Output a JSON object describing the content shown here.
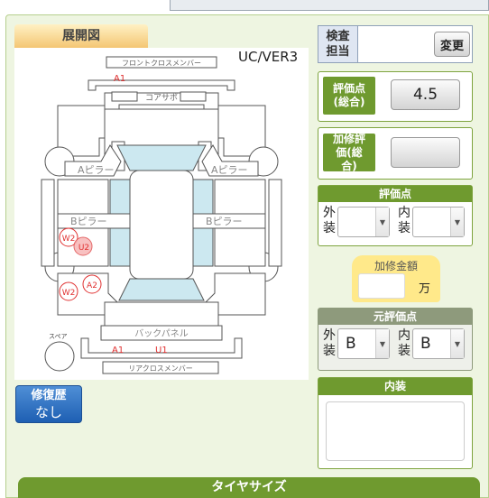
{
  "diagram": {
    "tab_label": "展開図",
    "version": "UC/VER3",
    "parts": {
      "front_cross": "フロントクロスメンバー",
      "core_support": "コアサポ",
      "a_pillar_left": "Aピラー",
      "a_pillar_right": "Aピラー",
      "b_pillar_left": "Bピラー",
      "b_pillar_right": "Bピラー",
      "back_panel": "バックパネル",
      "rear_cross": "リアクロスメンバー",
      "spare": "スペア"
    },
    "marks": {
      "a1_front": "A1",
      "w2_upper": "W2",
      "u2": "U2",
      "w2_lower": "W2",
      "a2": "A2",
      "a1_rear": "A1",
      "u1": "U1"
    }
  },
  "inspector": {
    "label": "検査担当",
    "change_button": "変更"
  },
  "score": {
    "label": "評価点(総合)",
    "value": "4.5"
  },
  "repair_score": {
    "label": "加修評価(総合)",
    "value": ""
  },
  "eval_points": {
    "title": "評価点",
    "exterior_label": "外装",
    "interior_label": "内装",
    "exterior_value": "",
    "interior_value": ""
  },
  "repair_amount": {
    "title": "加修金額",
    "value": "",
    "unit": "万"
  },
  "original_points": {
    "title": "元評価点",
    "exterior_label": "外装",
    "interior_label": "内装",
    "exterior_value": "B",
    "interior_value": "B"
  },
  "interior": {
    "title": "内装",
    "text": ""
  },
  "repair_history": {
    "label": "修復歴",
    "value": "なし"
  },
  "tire": {
    "title": "タイヤサイズ"
  },
  "colors": {
    "green": "#6f9a2f",
    "blue_button": "#2a6bc0",
    "tab_orange": "#f4c673",
    "glass": "#cce8f0",
    "damage_mark": "#e03030"
  }
}
